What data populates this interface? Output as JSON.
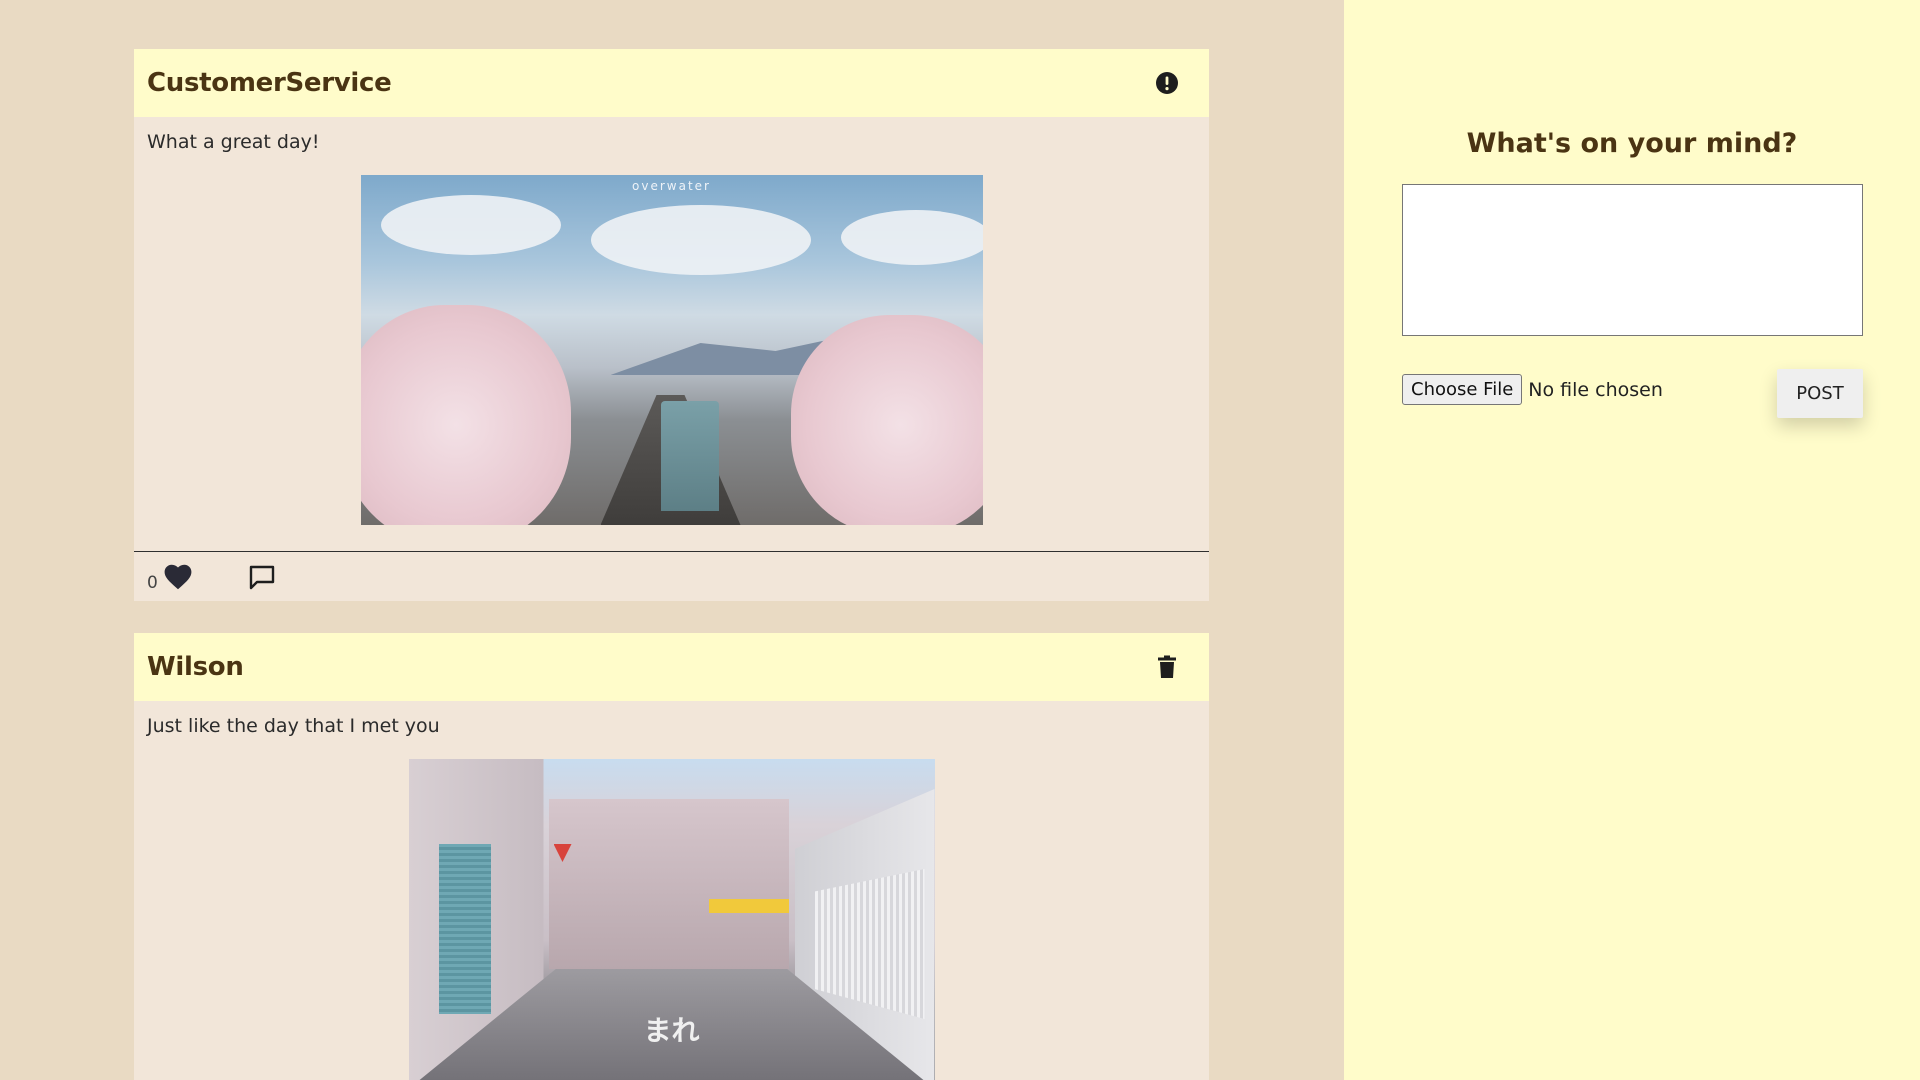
{
  "feed": {
    "posts": [
      {
        "author": "CustomerService",
        "header_icon": "exclamation-circle-icon",
        "text": "What a great day!",
        "image_alt": "overwater",
        "likes": "0",
        "show_actions": true
      },
      {
        "author": "Wilson",
        "header_icon": "trash-icon",
        "text": "Just like the day that I met you",
        "image_alt": "street photo",
        "road_text": "まれ"
      }
    ]
  },
  "composer": {
    "title": "What's on your mind?",
    "textarea_value": "",
    "choose_file_label": "Choose File",
    "file_status": "No file chosen",
    "post_label": "POST"
  },
  "colors": {
    "page_background": "#e9dac3",
    "sidebar_background": "#fffcca",
    "post_header_background": "#fffcca",
    "post_body_background": "#f2e6d9",
    "author_color": "#4a3413"
  }
}
